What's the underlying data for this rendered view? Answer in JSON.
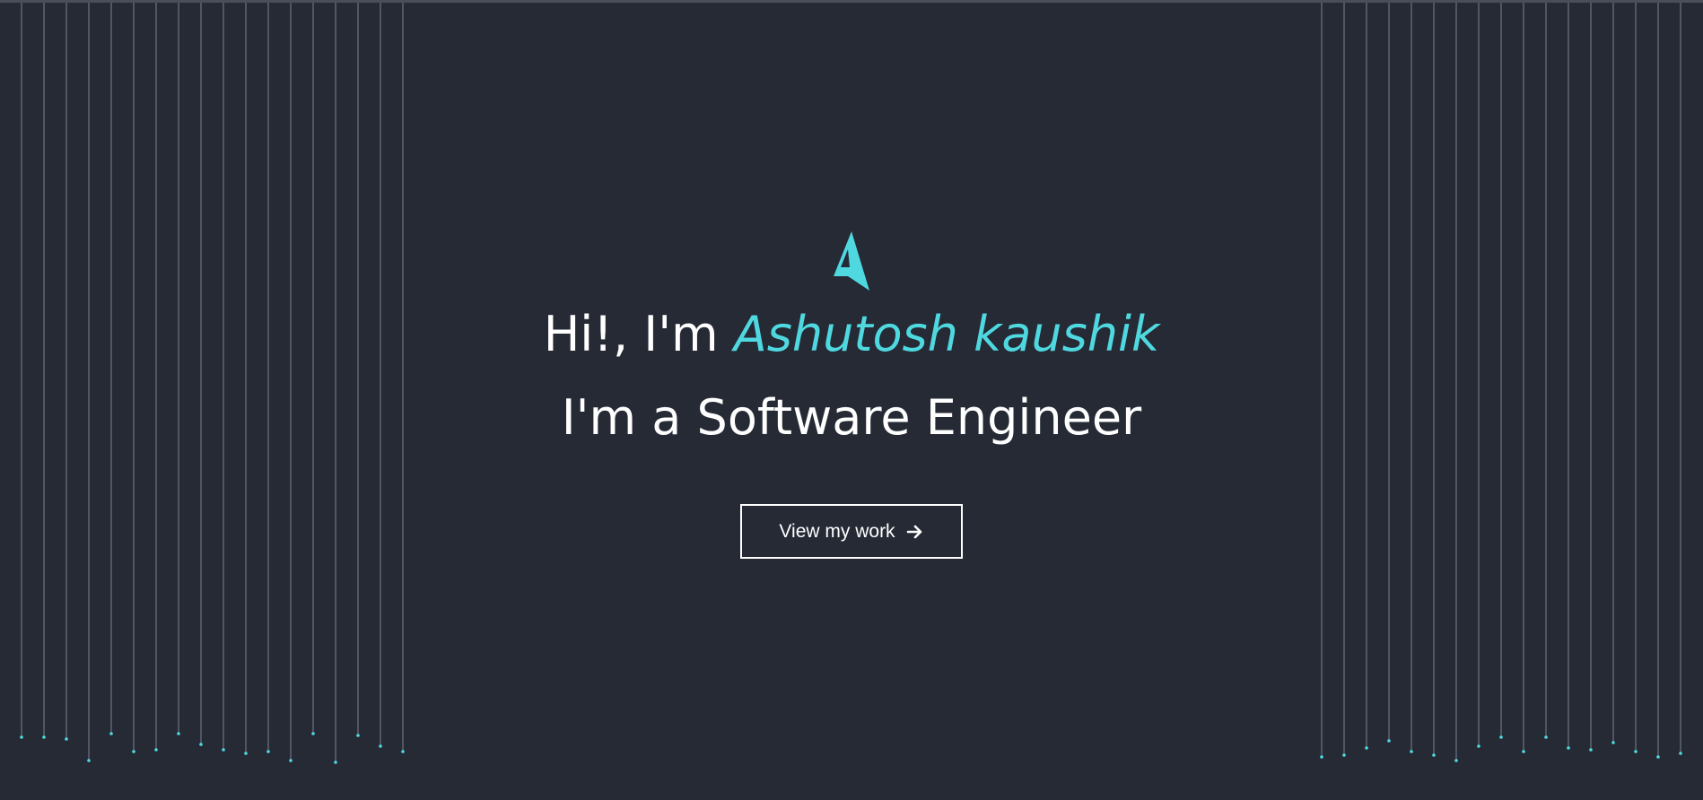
{
  "hero": {
    "greeting_prefix": "Hi!, I'm ",
    "name": "Ashutosh kaushik",
    "role": "I'm a Software Engineer",
    "cta_label": "View my work"
  },
  "icons": {
    "logo": "logo-icon",
    "cta": "arrow-right-icon"
  },
  "colors": {
    "background": "#252a35",
    "accent": "#4fd8e0",
    "text": "#ffffff",
    "string_line": "#5c6170"
  }
}
